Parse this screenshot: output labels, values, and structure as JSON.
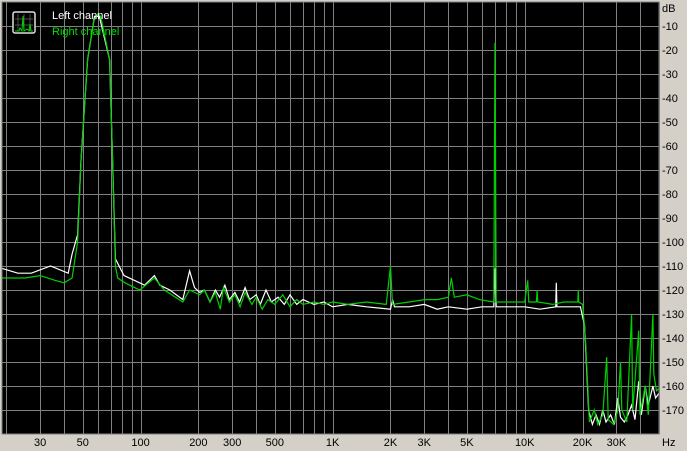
{
  "chart_data": {
    "type": "line",
    "title": "",
    "xlabel": "Hz",
    "ylabel": "dB",
    "xscale": "log",
    "xlim": [
      19,
      50000
    ],
    "ylim": [
      -180,
      0
    ],
    "grid": true,
    "legend_placement": "top-left",
    "x_ticks": [
      {
        "value": 30,
        "label": "30"
      },
      {
        "value": 50,
        "label": "50"
      },
      {
        "value": 100,
        "label": "100"
      },
      {
        "value": 200,
        "label": "200"
      },
      {
        "value": 300,
        "label": "300"
      },
      {
        "value": 500,
        "label": "500"
      },
      {
        "value": 1000,
        "label": "1K"
      },
      {
        "value": 2000,
        "label": "2K"
      },
      {
        "value": 3000,
        "label": "3K"
      },
      {
        "value": 5000,
        "label": "5K"
      },
      {
        "value": 10000,
        "label": "10K"
      },
      {
        "value": 20000,
        "label": "20K"
      },
      {
        "value": 30000,
        "label": "30K"
      }
    ],
    "y_ticks": [
      {
        "value": -10,
        "label": "-10"
      },
      {
        "value": -20,
        "label": "-20"
      },
      {
        "value": -30,
        "label": "-30"
      },
      {
        "value": -40,
        "label": "-40"
      },
      {
        "value": -50,
        "label": "-50"
      },
      {
        "value": -60,
        "label": "-60"
      },
      {
        "value": -70,
        "label": "-70"
      },
      {
        "value": -80,
        "label": "-80"
      },
      {
        "value": -90,
        "label": "-90"
      },
      {
        "value": -100,
        "label": "-100"
      },
      {
        "value": -110,
        "label": "-110"
      },
      {
        "value": -120,
        "label": "-120"
      },
      {
        "value": -130,
        "label": "-130"
      },
      {
        "value": -140,
        "label": "-140"
      },
      {
        "value": -150,
        "label": "-150"
      },
      {
        "value": -160,
        "label": "-160"
      },
      {
        "value": -170,
        "label": "-170"
      }
    ],
    "series": [
      {
        "name": "Left channel",
        "color": "#ffffff",
        "points": [
          [
            19,
            -111
          ],
          [
            23,
            -113
          ],
          [
            27,
            -113
          ],
          [
            34,
            -110
          ],
          [
            42,
            -113
          ],
          [
            44,
            -105
          ],
          [
            47,
            -97
          ],
          [
            49,
            -66
          ],
          [
            53,
            -24
          ],
          [
            57.6,
            -6
          ],
          [
            61,
            -6
          ],
          [
            69,
            -24
          ],
          [
            71.5,
            -66
          ],
          [
            74,
            -107
          ],
          [
            82,
            -114
          ],
          [
            93,
            -116
          ],
          [
            105,
            -118
          ],
          [
            118,
            -114
          ],
          [
            126,
            -118
          ],
          [
            142,
            -120
          ],
          [
            166,
            -124
          ],
          [
            180,
            -112
          ],
          [
            191,
            -119
          ],
          [
            203,
            -121
          ],
          [
            215,
            -120
          ],
          [
            230,
            -125
          ],
          [
            245,
            -120
          ],
          [
            258,
            -123
          ],
          [
            275,
            -118
          ],
          [
            290,
            -124
          ],
          [
            310,
            -121
          ],
          [
            328,
            -125
          ],
          [
            350,
            -119
          ],
          [
            370,
            -124
          ],
          [
            400,
            -122
          ],
          [
            420,
            -126
          ],
          [
            450,
            -120
          ],
          [
            480,
            -125
          ],
          [
            520,
            -123
          ],
          [
            560,
            -126
          ],
          [
            600,
            -122
          ],
          [
            650,
            -126
          ],
          [
            700,
            -124
          ],
          [
            800,
            -126
          ],
          [
            900,
            -125
          ],
          [
            1000,
            -127
          ],
          [
            1200,
            -126
          ],
          [
            1500,
            -127
          ],
          [
            2000,
            -128
          ],
          [
            2050,
            -124
          ],
          [
            2100,
            -127
          ],
          [
            2500,
            -127
          ],
          [
            3000,
            -126
          ],
          [
            3500,
            -128
          ],
          [
            4000,
            -127
          ],
          [
            5000,
            -128
          ],
          [
            6000,
            -127
          ],
          [
            6900,
            -127
          ],
          [
            7000,
            -111
          ],
          [
            7100,
            -127
          ],
          [
            8000,
            -127
          ],
          [
            10000,
            -127
          ],
          [
            12000,
            -128
          ],
          [
            14500,
            -127
          ],
          [
            14600,
            -117
          ],
          [
            14700,
            -127
          ],
          [
            17000,
            -127
          ],
          [
            19500,
            -127
          ],
          [
            20500,
            -135
          ],
          [
            21500,
            -170
          ],
          [
            22500,
            -176
          ],
          [
            23500,
            -172
          ],
          [
            24500,
            -176
          ],
          [
            25500,
            -170
          ],
          [
            26500,
            -175
          ],
          [
            28000,
            -172
          ],
          [
            29300,
            -176
          ],
          [
            30500,
            -165
          ],
          [
            31500,
            -173
          ],
          [
            33000,
            -175
          ],
          [
            34500,
            -172
          ],
          [
            36000,
            -168
          ],
          [
            37500,
            -174
          ],
          [
            39200,
            -158
          ],
          [
            40500,
            -172
          ],
          [
            42400,
            -160
          ],
          [
            44000,
            -168
          ],
          [
            46500,
            -160
          ],
          [
            48000,
            -165
          ],
          [
            50000,
            -163
          ]
        ]
      },
      {
        "name": "Right channel",
        "color": "#00d000",
        "points": [
          [
            19,
            -115
          ],
          [
            25,
            -115
          ],
          [
            30,
            -114
          ],
          [
            36,
            -116
          ],
          [
            40,
            -117
          ],
          [
            44,
            -115
          ],
          [
            47,
            -100
          ],
          [
            49,
            -66
          ],
          [
            53,
            -24
          ],
          [
            57,
            -8
          ],
          [
            60,
            -5
          ],
          [
            62,
            -6
          ],
          [
            69,
            -24
          ],
          [
            71.5,
            -66
          ],
          [
            74,
            -110
          ],
          [
            76,
            -115
          ],
          [
            83,
            -117
          ],
          [
            99,
            -120
          ],
          [
            118,
            -115
          ],
          [
            133,
            -120
          ],
          [
            166,
            -125
          ],
          [
            180,
            -120
          ],
          [
            203,
            -122
          ],
          [
            215,
            -120
          ],
          [
            230,
            -125
          ],
          [
            245,
            -121
          ],
          [
            260,
            -128
          ],
          [
            270,
            -119
          ],
          [
            290,
            -125
          ],
          [
            310,
            -122
          ],
          [
            330,
            -127
          ],
          [
            350,
            -121
          ],
          [
            380,
            -126
          ],
          [
            400,
            -123
          ],
          [
            430,
            -128
          ],
          [
            460,
            -124
          ],
          [
            500,
            -126
          ],
          [
            550,
            -122
          ],
          [
            600,
            -127
          ],
          [
            650,
            -124
          ],
          [
            700,
            -126
          ],
          [
            800,
            -125
          ],
          [
            900,
            -126
          ],
          [
            1000,
            -125
          ],
          [
            1200,
            -126
          ],
          [
            1500,
            -125
          ],
          [
            1900,
            -126
          ],
          [
            2000,
            -110
          ],
          [
            2050,
            -126
          ],
          [
            2500,
            -125
          ],
          [
            3000,
            -124
          ],
          [
            3500,
            -124
          ],
          [
            4000,
            -123
          ],
          [
            4150,
            -115
          ],
          [
            4300,
            -123
          ],
          [
            5000,
            -122
          ],
          [
            5800,
            -124
          ],
          [
            6900,
            -125
          ],
          [
            7000,
            -17
          ],
          [
            7100,
            -125
          ],
          [
            8000,
            -125
          ],
          [
            10000,
            -125
          ],
          [
            10360,
            -116
          ],
          [
            10500,
            -125
          ],
          [
            11500,
            -125
          ],
          [
            11600,
            -120
          ],
          [
            11700,
            -125
          ],
          [
            14000,
            -126
          ],
          [
            16000,
            -125
          ],
          [
            18900,
            -125
          ],
          [
            19000,
            -120
          ],
          [
            19100,
            -125
          ],
          [
            20000,
            -126
          ],
          [
            20700,
            -140
          ],
          [
            21700,
            -175
          ],
          [
            23000,
            -170
          ],
          [
            24000,
            -176
          ],
          [
            25500,
            -172
          ],
          [
            26700,
            -148
          ],
          [
            27200,
            -174
          ],
          [
            29000,
            -176
          ],
          [
            30500,
            -170
          ],
          [
            31500,
            -150
          ],
          [
            32000,
            -170
          ],
          [
            34000,
            -175
          ],
          [
            36000,
            -130
          ],
          [
            36500,
            -170
          ],
          [
            39200,
            -137
          ],
          [
            39800,
            -172
          ],
          [
            42400,
            -160
          ],
          [
            44000,
            -172
          ],
          [
            46500,
            -130
          ],
          [
            47000,
            -155
          ],
          [
            48500,
            -162
          ],
          [
            50000,
            -161
          ]
        ]
      }
    ]
  },
  "colors": {
    "plot_bg": "#000000",
    "grid": "#808080",
    "frame": "#d4d0c8"
  },
  "legend": {
    "icon": "spectrum-icon",
    "left_label": "Left channel",
    "right_label": "Right channel"
  }
}
